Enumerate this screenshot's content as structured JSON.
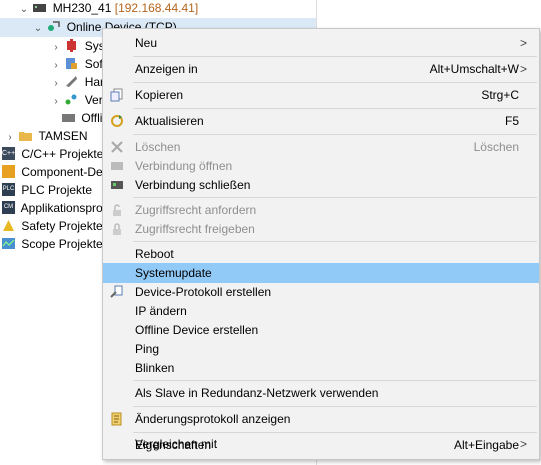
{
  "tree": {
    "root": {
      "label": "MH230_41",
      "ip": "[192.168.44.41]"
    },
    "online_device": "Online Device (TCP)",
    "children": [
      "Syst",
      "Soft",
      "Har",
      "Verr"
    ],
    "offline": "Offline",
    "tamsen": "TAMSEN",
    "projects": [
      "C/C++ Projekte",
      "Component-Des",
      "PLC Projekte",
      "Applikationspro",
      "Safety Projekte",
      "Scope Projekte"
    ],
    "icon_texts": {
      "c": "C++",
      "plc": "PLC",
      "cm": "CM"
    }
  },
  "menu": {
    "neu": "Neu",
    "anzeigen_in": "Anzeigen in",
    "anzeigen_in_shortcut": "Alt+Umschalt+W",
    "kopieren": "Kopieren",
    "kopieren_shortcut": "Strg+C",
    "aktualisieren": "Aktualisieren",
    "aktualisieren_shortcut": "F5",
    "loeschen": "Löschen",
    "loeschen_shortcut": "Löschen",
    "verbindung_oeffnen": "Verbindung öffnen",
    "verbindung_schliessen": "Verbindung schließen",
    "zugriffsrecht_anfordern": "Zugriffsrecht anfordern",
    "zugriffsrecht_freigeben": "Zugriffsrecht freigeben",
    "reboot": "Reboot",
    "systemupdate": "Systemupdate",
    "device_protokoll": "Device-Protokoll erstellen",
    "ip_aendern": "IP ändern",
    "offline_device": "Offline Device erstellen",
    "ping": "Ping",
    "blinken": "Blinken",
    "als_slave": "Als Slave in Redundanz-Netzwerk verwenden",
    "aenderungsprotokoll": "Änderungsprotokoll anzeigen",
    "eigenschaften": "Eigenschaften",
    "eigenschaften_shortcut": "Alt+Eingabe",
    "vergleichen_mit": "Vergleichen mit",
    "submenu_arrow": ">"
  },
  "colors": {
    "menu_bg": "#f2f2f2",
    "hover": "#91c9f7",
    "disabled_text": "#8f8f8f",
    "selection": "#dbe9f7",
    "ip_text": "#b5651d"
  }
}
